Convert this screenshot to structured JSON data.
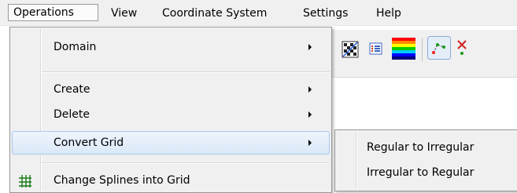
{
  "menubar": {
    "items": [
      "Operations",
      "View",
      "Coordinate System",
      "Settings",
      "Help"
    ]
  },
  "dropdown": {
    "items": [
      {
        "label": "Domain",
        "submenu": true
      },
      {
        "label": "Create",
        "submenu": true
      },
      {
        "label": "Delete",
        "submenu": true
      },
      {
        "label": "Convert Grid",
        "submenu": true,
        "highlighted": true
      },
      {
        "label": "Change Splines into Grid",
        "icon": "grid-icon"
      }
    ]
  },
  "submenu": {
    "items": [
      "Regular to Irregular",
      "Irregular to Regular"
    ]
  },
  "toolbar": {
    "icons": [
      "checker-grid-icon",
      "list-icon",
      "color-ramp-icon",
      "spline-points-icon",
      "delete-spline-icon"
    ]
  },
  "colors": {
    "menu_bg": "#f0f0f0",
    "highlight_border": "#a8c8ee",
    "highlight_fill": "#dbe8f8"
  }
}
